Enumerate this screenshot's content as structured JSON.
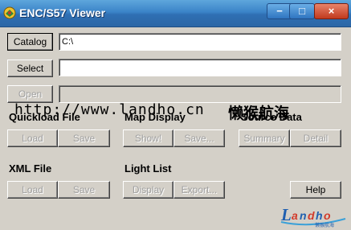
{
  "window": {
    "title": "ENC/S57 Viewer"
  },
  "title_buttons": {
    "minimize": "−",
    "maximize": "□",
    "close": "×"
  },
  "top": {
    "catalog_label": "Catalog",
    "catalog_value": "C:\\",
    "select_label": "Select",
    "select_value": "",
    "open_label": "Open",
    "open_value": ""
  },
  "watermark": {
    "url": "http://www.landho.cn",
    "cn": "懒猴航海"
  },
  "groups": {
    "quickload": {
      "title": "Quickload File",
      "load": "Load",
      "save": "Save"
    },
    "map_display": {
      "title": "Map Display",
      "show": "Show!",
      "save": "Save..."
    },
    "source_data": {
      "title": "Source Data",
      "summary": "Summary",
      "detail": "Detail"
    },
    "xml_file": {
      "title": "XML File",
      "load": "Load",
      "save": "Save"
    },
    "light_list": {
      "title": "Light List",
      "display": "Display",
      "export": "Export..."
    }
  },
  "help_label": "Help",
  "logo": {
    "text": "Landho",
    "subtext": "懒猴航海"
  }
}
